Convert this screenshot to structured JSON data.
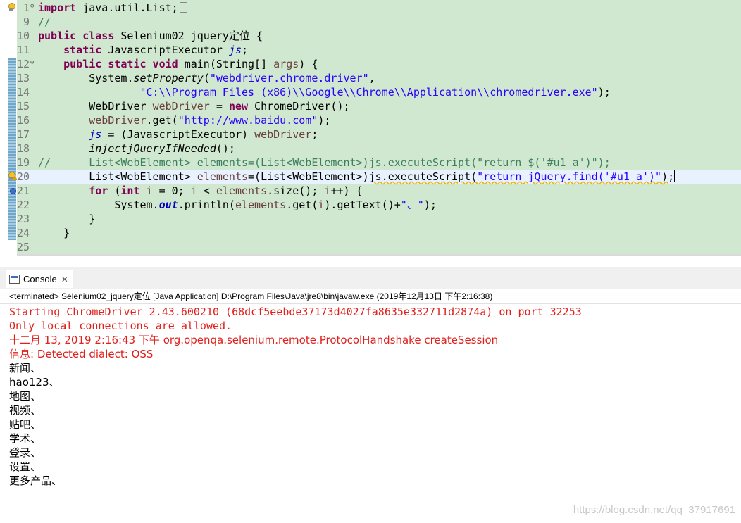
{
  "editor": {
    "lines": [
      {
        "num": "1",
        "fold": "⊕",
        "segments": [
          {
            "t": "import",
            "c": "kw"
          },
          {
            "t": " java.util.List;"
          }
        ],
        "collapsed_box": true
      },
      {
        "num": "9",
        "segments": [
          {
            "t": "//",
            "c": "cm"
          }
        ]
      },
      {
        "num": "10",
        "segments": [
          {
            "t": "public class",
            "c": "kw"
          },
          {
            "t": " Selenium02_jquery定位 {"
          }
        ]
      },
      {
        "num": "11",
        "segments": [
          {
            "t": "    "
          },
          {
            "t": "static",
            "c": "kw"
          },
          {
            "t": " JavascriptExecutor "
          },
          {
            "t": "js",
            "c": "fld"
          },
          {
            "t": ";"
          }
        ]
      },
      {
        "num": "12",
        "fold": "⊖",
        "segments": [
          {
            "t": "    "
          },
          {
            "t": "public static void",
            "c": "kw"
          },
          {
            "t": " main(String[] "
          },
          {
            "t": "args",
            "c": "loc"
          },
          {
            "t": ") {"
          }
        ]
      },
      {
        "num": "13",
        "segments": [
          {
            "t": "        System."
          },
          {
            "t": "setProperty",
            "c": "it"
          },
          {
            "t": "("
          },
          {
            "t": "\"webdriver.chrome.driver\"",
            "c": "str"
          },
          {
            "t": ","
          }
        ]
      },
      {
        "num": "14",
        "segments": [
          {
            "t": "                "
          },
          {
            "t": "\"C:\\\\Program Files (x86)\\\\Google\\\\Chrome\\\\Application\\\\chromedriver.exe\"",
            "c": "str"
          },
          {
            "t": ");"
          }
        ]
      },
      {
        "num": "15",
        "segments": [
          {
            "t": "        WebDriver "
          },
          {
            "t": "webDriver",
            "c": "loc"
          },
          {
            "t": " = "
          },
          {
            "t": "new",
            "c": "kw"
          },
          {
            "t": " ChromeDriver();"
          }
        ]
      },
      {
        "num": "16",
        "segments": [
          {
            "t": "        "
          },
          {
            "t": "webDriver",
            "c": "loc"
          },
          {
            "t": ".get("
          },
          {
            "t": "\"http://www.baidu.com\"",
            "c": "str"
          },
          {
            "t": ");"
          }
        ]
      },
      {
        "num": "17",
        "segments": [
          {
            "t": "        "
          },
          {
            "t": "js",
            "c": "fld"
          },
          {
            "t": " = (JavascriptExecutor) "
          },
          {
            "t": "webDriver",
            "c": "loc"
          },
          {
            "t": ";"
          }
        ]
      },
      {
        "num": "18",
        "segments": [
          {
            "t": "        "
          },
          {
            "t": "injectjQueryIfNeeded",
            "c": "it"
          },
          {
            "t": "();"
          }
        ]
      },
      {
        "num": "19",
        "segments": [
          {
            "t": "//      List<WebElement> elements=(List<WebElement>)js.executeScript(\"return $('#u1 a')\");",
            "c": "cm"
          }
        ]
      },
      {
        "num": "20",
        "current": true,
        "segments": [
          {
            "t": "        List<WebElement> "
          },
          {
            "t": "elements",
            "c": "loc"
          },
          {
            "t": "=(List<WebElement>)"
          },
          {
            "t": "js.executeScript(",
            "c": "warn-u"
          },
          {
            "t": "\"return jQuery.find('#u1 a')\"",
            "c": "str warn-u"
          },
          {
            "t": ")",
            "c": "warn-u"
          },
          {
            "t": ";"
          }
        ],
        "caret": true
      },
      {
        "num": "21",
        "segments": [
          {
            "t": "        "
          },
          {
            "t": "for",
            "c": "kw"
          },
          {
            "t": " ("
          },
          {
            "t": "int",
            "c": "kw"
          },
          {
            "t": " "
          },
          {
            "t": "i",
            "c": "loc"
          },
          {
            "t": " = 0; "
          },
          {
            "t": "i",
            "c": "loc"
          },
          {
            "t": " < "
          },
          {
            "t": "elements",
            "c": "loc"
          },
          {
            "t": ".size(); "
          },
          {
            "t": "i",
            "c": "loc"
          },
          {
            "t": "++) {"
          }
        ]
      },
      {
        "num": "22",
        "segments": [
          {
            "t": "            System."
          },
          {
            "t": "out",
            "c": "fldb"
          },
          {
            "t": ".println("
          },
          {
            "t": "elements",
            "c": "loc"
          },
          {
            "t": ".get("
          },
          {
            "t": "i",
            "c": "loc"
          },
          {
            "t": ").getText()+"
          },
          {
            "t": "\"、\"",
            "c": "str"
          },
          {
            "t": ");"
          }
        ]
      },
      {
        "num": "23",
        "segments": [
          {
            "t": "        }"
          }
        ]
      },
      {
        "num": "24",
        "segments": [
          {
            "t": "    }"
          }
        ]
      },
      {
        "num": "25",
        "segments": []
      }
    ]
  },
  "console": {
    "tab_label": "Console",
    "status": "<terminated> Selenium02_jquery定位 [Java Application] D:\\Program Files\\Java\\jre8\\bin\\javaw.exe (2019年12月13日 下午2:16:38)",
    "output": [
      {
        "text": "Starting ChromeDriver 2.43.600210 (68dcf5eebde37173d4027fa8635e332711d2874a) on port 32253",
        "kind": "err"
      },
      {
        "text": "Only local connections are allowed.",
        "kind": "err"
      },
      {
        "text": "十二月 13, 2019 2:16:43 下午 org.openqa.selenium.remote.ProtocolHandshake createSession",
        "kind": "err"
      },
      {
        "text": "信息: Detected dialect: OSS",
        "kind": "err"
      },
      {
        "text": "新闻、",
        "kind": "std"
      },
      {
        "text": "hao123、",
        "kind": "std"
      },
      {
        "text": "地图、",
        "kind": "std"
      },
      {
        "text": "视频、",
        "kind": "std"
      },
      {
        "text": "贴吧、",
        "kind": "std"
      },
      {
        "text": "学术、",
        "kind": "std"
      },
      {
        "text": "登录、",
        "kind": "std"
      },
      {
        "text": "设置、",
        "kind": "std"
      },
      {
        "text": "更多产品、",
        "kind": "std"
      }
    ]
  },
  "watermark": "https://blog.csdn.net/qq_37917691"
}
